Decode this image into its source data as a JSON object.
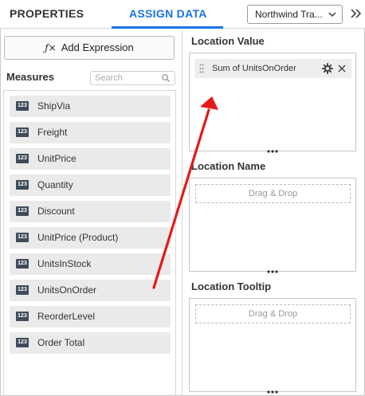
{
  "header": {
    "tabs": [
      {
        "label": "PROPERTIES",
        "active": false
      },
      {
        "label": "ASSIGN DATA",
        "active": true
      }
    ],
    "datasource_value": "Northwind Tra...",
    "accent_color": "#1a73e8"
  },
  "left": {
    "add_expression_label": "Add Expression",
    "measures_label": "Measures",
    "search_placeholder": "Search",
    "badge_text": "123",
    "measures": [
      {
        "label": "ShipVia"
      },
      {
        "label": "Freight"
      },
      {
        "label": "UnitPrice"
      },
      {
        "label": "Quantity"
      },
      {
        "label": "Discount"
      },
      {
        "label": "UnitPrice (Product)"
      },
      {
        "label": "UnitsInStock"
      },
      {
        "label": "UnitsOnOrder"
      },
      {
        "label": "ReorderLevel"
      },
      {
        "label": "Order Total"
      }
    ]
  },
  "right": {
    "sections": [
      {
        "title": "Location Value",
        "field": "Sum of UnitsOnOrder"
      },
      {
        "title": "Location Name",
        "hint": "Drag & Drop"
      },
      {
        "title": "Location Tooltip",
        "hint": "Drag & Drop"
      }
    ]
  },
  "annotation": {
    "arrow_color": "#e41a1a"
  }
}
